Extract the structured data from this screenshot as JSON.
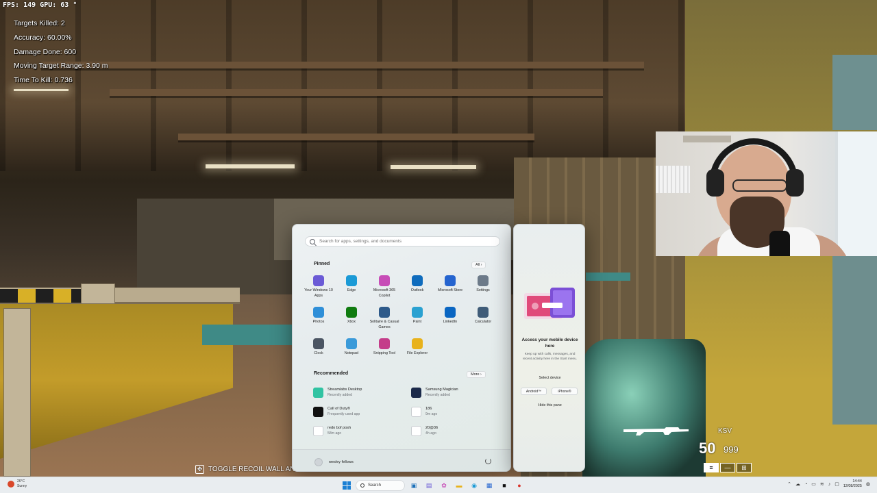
{
  "hud": {
    "fps_line": "FPS: 149  GPU: 63 °",
    "stats": [
      "Targets Killed: 2",
      "Accuracy: 60.00%",
      "Damage Done:  600",
      "Moving Target Range:  3.90 m",
      "Time To Kill: 0.736"
    ],
    "hint_text": "TOGGLE RECOIL WALL AND",
    "weapon_name": "KSV",
    "mag_ammo": "50",
    "reserve_ammo": "999"
  },
  "start_menu": {
    "search_placeholder": "Search for apps, settings, and documents",
    "pinned_title": "Pinned",
    "all_label": "All  ›",
    "pinned": [
      {
        "label": "Your Windows 10 Apps",
        "color": "#6b5bd6",
        "icon": "windows-apps-icon"
      },
      {
        "label": "Edge",
        "color": "#1b9ad6",
        "icon": "edge-icon"
      },
      {
        "label": "Microsoft 365 Copilot",
        "color": "#c74db7",
        "icon": "copilot-icon"
      },
      {
        "label": "Outlook",
        "color": "#0f6cbd",
        "icon": "outlook-icon"
      },
      {
        "label": "Microsoft Store",
        "color": "#2564cf",
        "icon": "store-icon"
      },
      {
        "label": "Settings",
        "color": "#6c7a89",
        "icon": "gear-icon"
      },
      {
        "label": "Photos",
        "color": "#2f8fd8",
        "icon": "photos-icon"
      },
      {
        "label": "Xbox",
        "color": "#107c10",
        "icon": "xbox-icon"
      },
      {
        "label": "Solitaire & Casual Games",
        "color": "#2d5a8a",
        "icon": "solitaire-icon"
      },
      {
        "label": "Paint",
        "color": "#2aa1d1",
        "icon": "paint-icon"
      },
      {
        "label": "LinkedIn",
        "color": "#0a66c2",
        "icon": "linkedin-icon"
      },
      {
        "label": "Calculator",
        "color": "#3f5c78",
        "icon": "calculator-icon"
      },
      {
        "label": "Clock",
        "color": "#4b5563",
        "icon": "clock-icon"
      },
      {
        "label": "Notepad",
        "color": "#3a9ad9",
        "icon": "notepad-icon"
      },
      {
        "label": "Snipping Tool",
        "color": "#c43d8a",
        "icon": "snipping-icon"
      },
      {
        "label": "File Explorer",
        "color": "#e8b21c",
        "icon": "folder-icon"
      }
    ],
    "recommended_title": "Recommended",
    "more_label": "More  ›",
    "recommended": [
      {
        "name": "Streamlabs Desktop",
        "sub": "Recently added",
        "color": "#31c3a2",
        "icon": "streamlabs-icon"
      },
      {
        "name": "Samsung Magician",
        "sub": "Recently added",
        "color": "#1b2a4a",
        "icon": "samsung-magician-icon"
      },
      {
        "name": "Call of Duty®",
        "sub": "Frequently used app",
        "color": "#111111",
        "icon": "call-of-duty-icon"
      },
      {
        "name": "186",
        "sub": "9m ago",
        "color": "#ffffff",
        "icon": "file-icon"
      },
      {
        "name": "redo bof posh",
        "sub": "58m ago",
        "color": "#ffffff",
        "icon": "file-icon"
      },
      {
        "name": "20@36",
        "sub": "4h ago",
        "color": "#ffffff",
        "icon": "document-icon"
      }
    ],
    "user_name": "wesley fellows"
  },
  "phone_panel": {
    "title": "Access your mobile device here",
    "description": "Keep up with calls, messages, and recent activity here in the Start menu.",
    "select_device": "Select device",
    "android": "Android™",
    "iphone": "iPhone®",
    "hide": "Hide this pane"
  },
  "taskbar": {
    "temp": "26°C",
    "condition": "Sunny",
    "search_label": "Search",
    "time": "14:44",
    "date": "12/08/2025"
  }
}
